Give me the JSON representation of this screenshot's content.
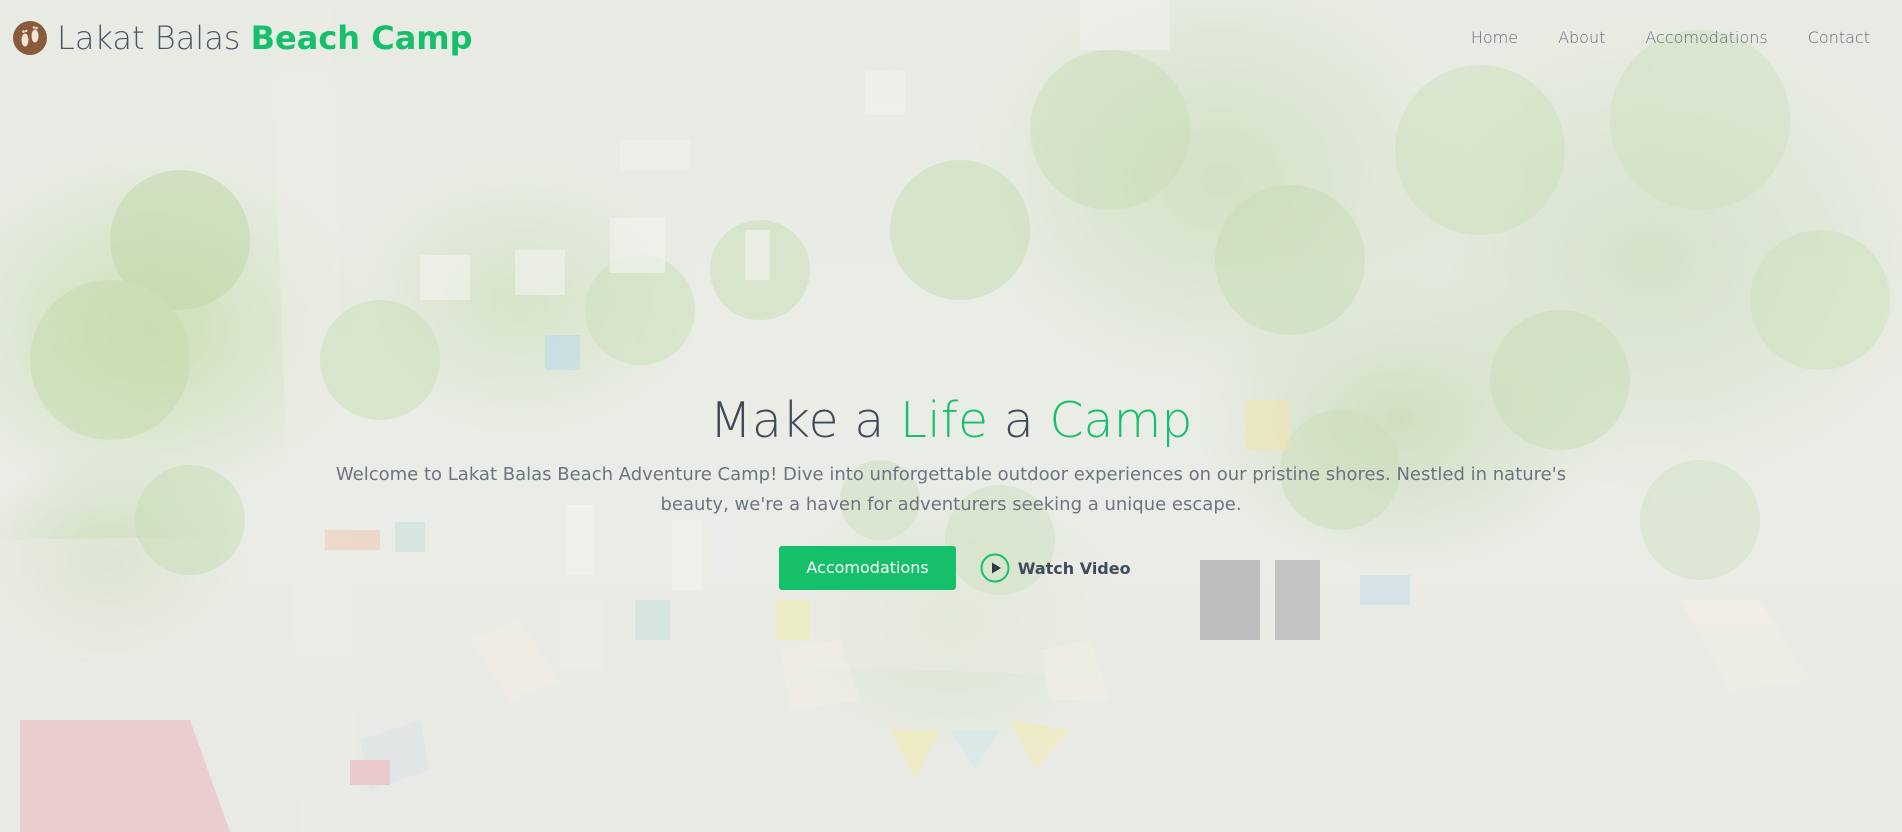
{
  "brand": {
    "name_plain": "Lakat Balas",
    "name_accent": "Beach Camp",
    "logo_icon": "footprints-icon",
    "accent_color": "#16c06a",
    "logo_color": "#8b5a3c"
  },
  "nav": {
    "items": [
      {
        "label": "Home"
      },
      {
        "label": "About"
      },
      {
        "label": "Accomodations"
      },
      {
        "label": "Contact"
      }
    ]
  },
  "hero": {
    "title_part1": "Make a ",
    "title_accent1": "Life",
    "title_part2": " a ",
    "title_accent2": "Camp",
    "description": "Welcome to Lakat Balas Beach Adventure Camp! Dive into unforgettable outdoor experiences on our pristine shores. Nestled in nature's beauty, we're a haven for adventurers seeking a unique escape.",
    "primary_button": "Accomodations",
    "video_button": "Watch Video",
    "video_icon": "play-circle-icon"
  }
}
